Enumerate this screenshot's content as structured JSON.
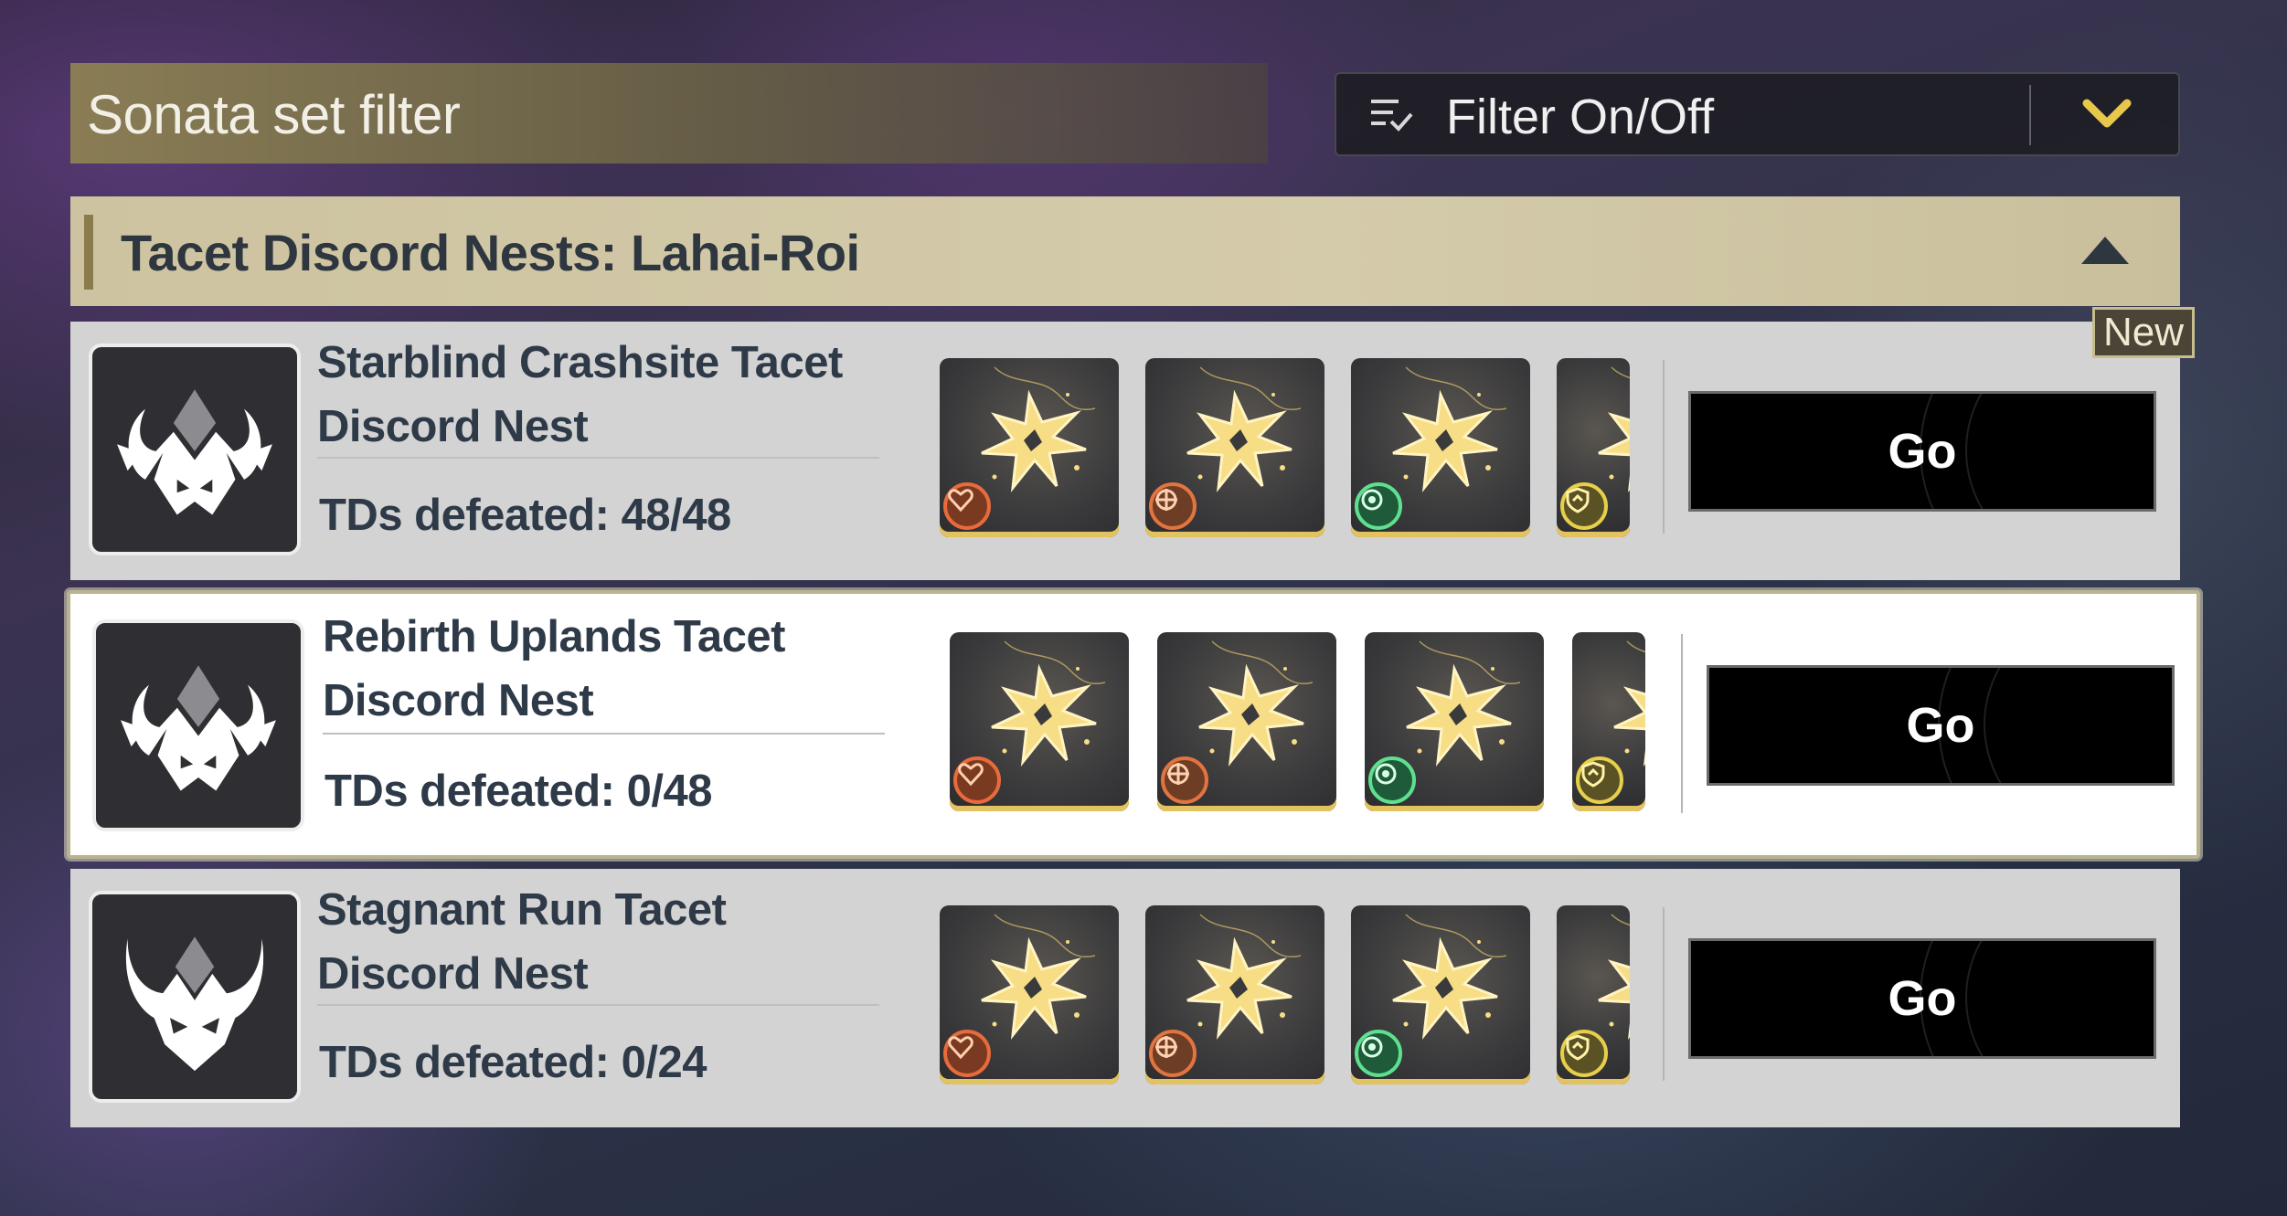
{
  "header": {
    "title": "Sonata set filter"
  },
  "filter": {
    "label": "Filter On/Off",
    "icon": "filter-list-icon",
    "chevron": "chevron-down-icon"
  },
  "section": {
    "title": "Tacet Discord Nests: Lahai-Roi",
    "toggle_icon": "caret-up-icon"
  },
  "badge": {
    "new_label": "New"
  },
  "nests": [
    {
      "name_line1": "Starblind Crashsite Tacet",
      "name_line2": "Discord Nest",
      "defeated": "TDs defeated: 48/48",
      "go_label": "Go",
      "selected": false
    },
    {
      "name_line1": "Rebirth Uplands Tacet",
      "name_line2": "Discord Nest",
      "defeated": "TDs defeated: 0/48",
      "go_label": "Go",
      "selected": true
    },
    {
      "name_line1": "Stagnant Run Tacet",
      "name_line2": "Discord Nest",
      "defeated": "TDs defeated: 0/24",
      "go_label": "Go",
      "selected": false
    }
  ],
  "sonata_icons": [
    "heart-sonata-icon",
    "crosshair-sonata-icon",
    "target-sonata-icon",
    "shield-sonata-icon"
  ],
  "colors": {
    "accent_gold": "#c8bd8c",
    "go_button": "#000000",
    "row_bg": "#d3d3d3",
    "selected_row_bg": "#ffffff",
    "text_dark": "#2f3a48"
  }
}
